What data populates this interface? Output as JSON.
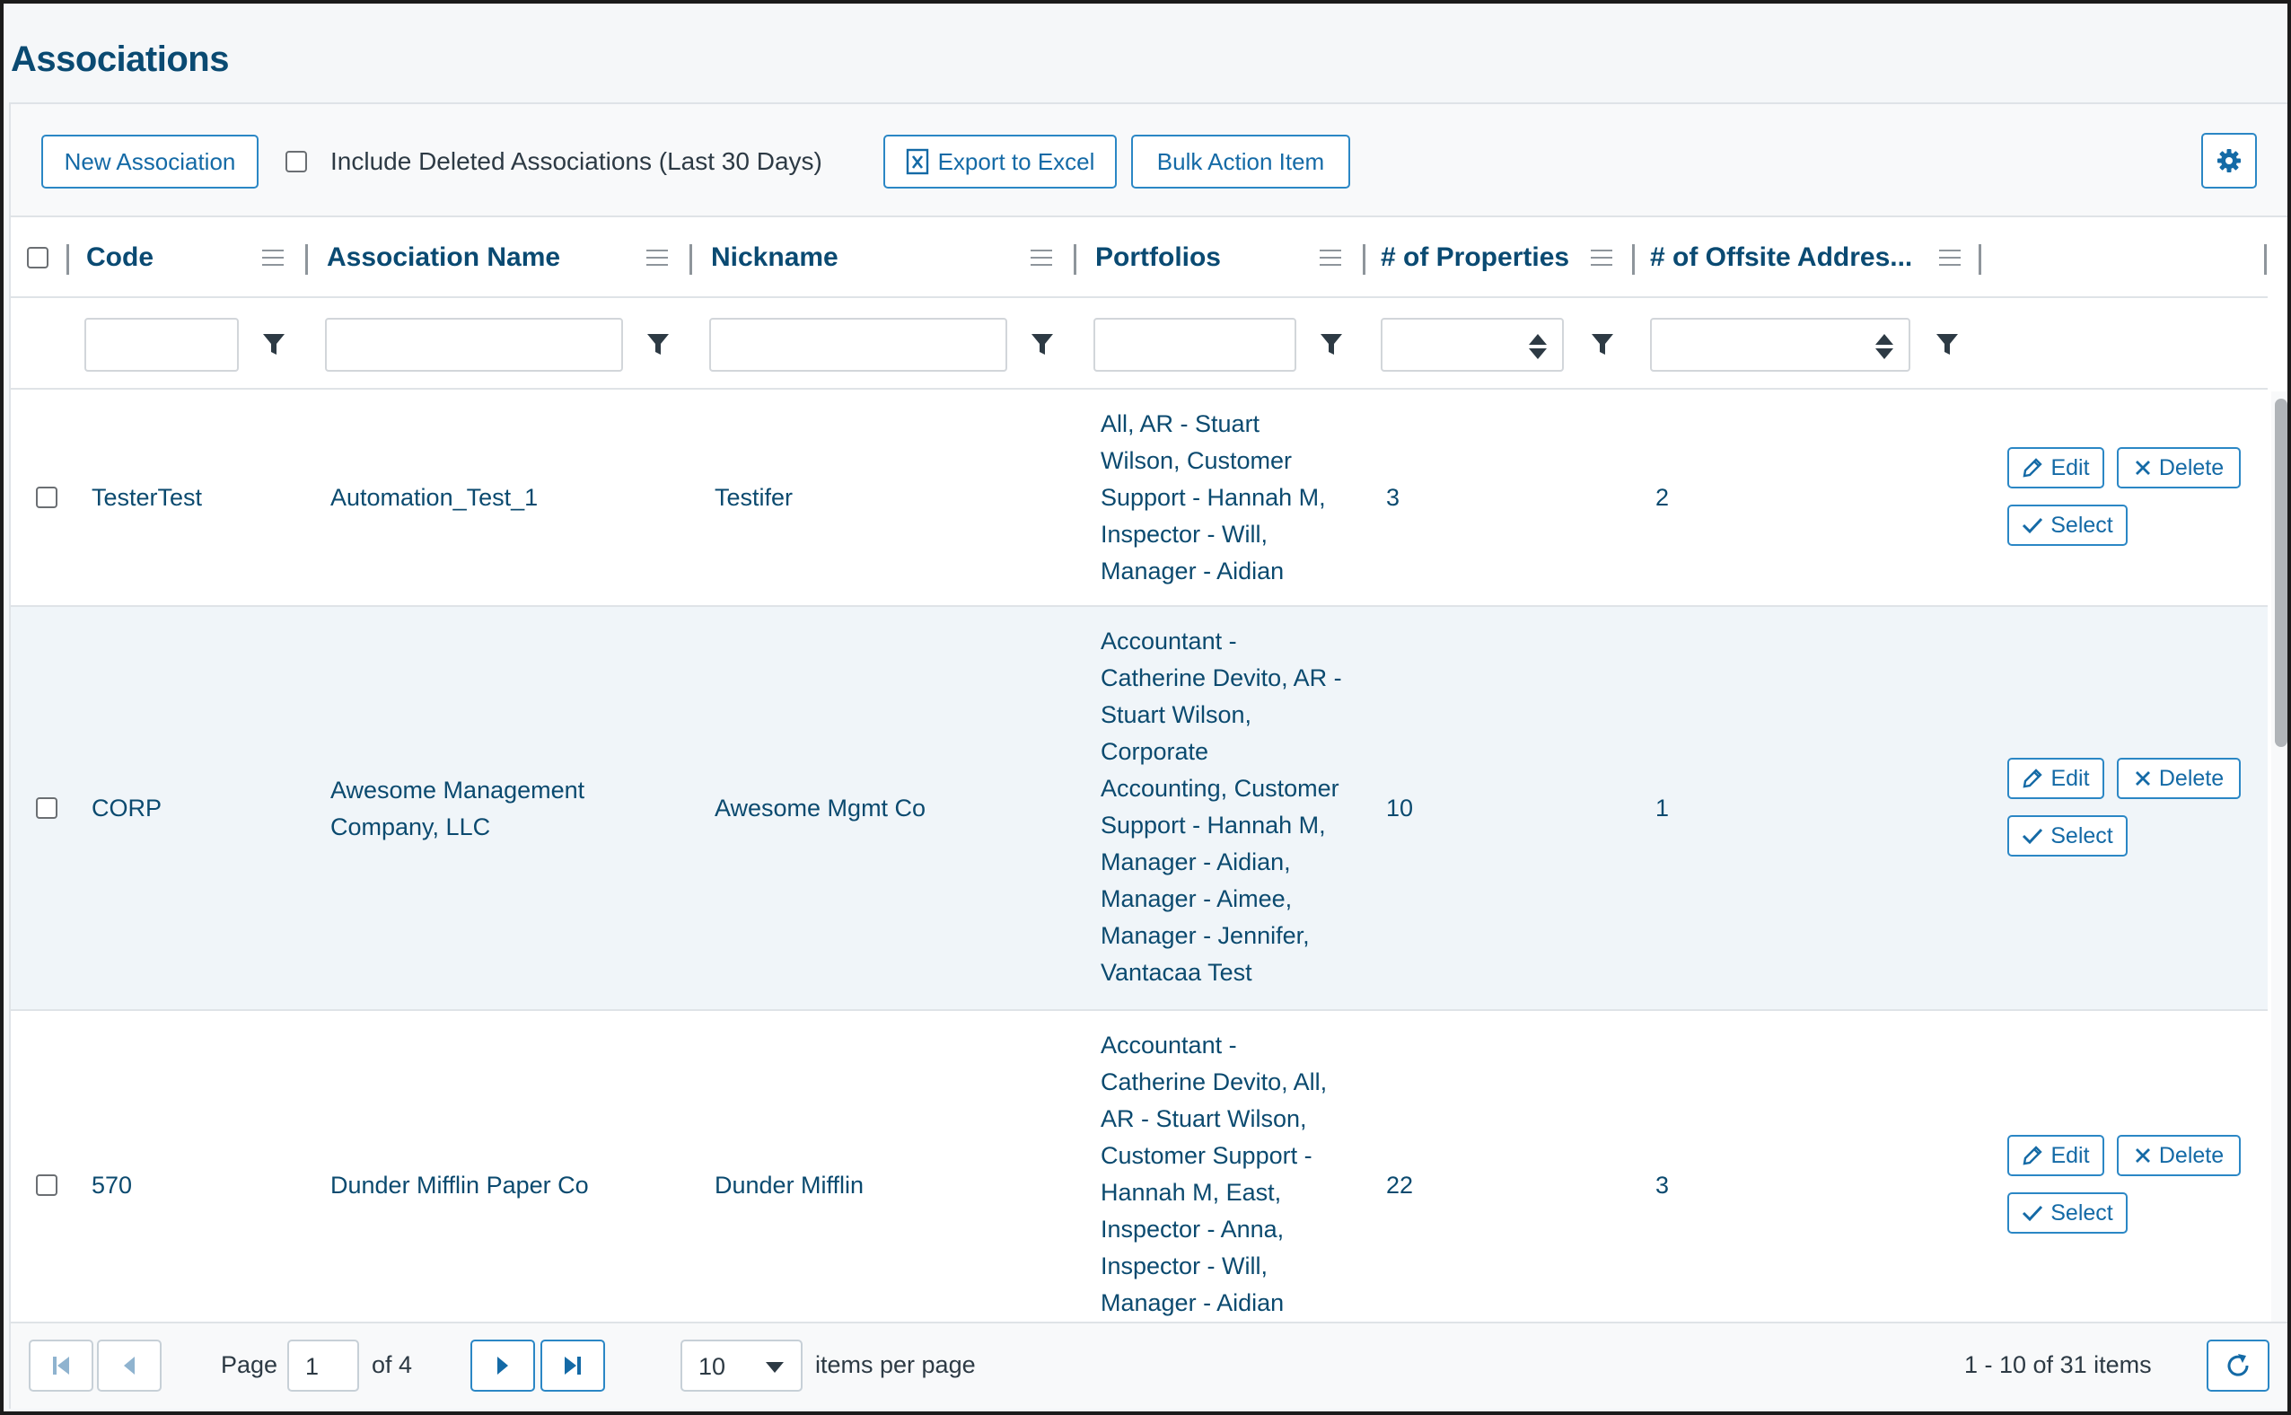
{
  "page": {
    "title": "Associations"
  },
  "toolbar": {
    "new_association": "New Association",
    "include_deleted": "Include Deleted Associations (Last 30 Days)",
    "export_excel": "Export to Excel",
    "bulk_action": "Bulk Action Item",
    "settings_icon": "gear-icon"
  },
  "columns": [
    {
      "label": "Code"
    },
    {
      "label": "Association Name"
    },
    {
      "label": "Nickname"
    },
    {
      "label": "Portfolios"
    },
    {
      "label": "# of Properties"
    },
    {
      "label": "# of Offsite Addres..."
    }
  ],
  "row_actions": {
    "edit": "Edit",
    "delete": "Delete",
    "select": "Select"
  },
  "rows": [
    {
      "code": "TesterTest",
      "name_lines": [
        "Automation_Test_1"
      ],
      "nickname": "Testifer",
      "portfolio_lines": [
        "All, AR - Stuart",
        "Wilson, Customer",
        "Support - Hannah M,",
        "Inspector - Will,",
        "Manager - Aidian"
      ],
      "properties": "3",
      "offsite": "2"
    },
    {
      "code": "CORP",
      "name_lines": [
        "Awesome Management",
        "Company, LLC"
      ],
      "nickname": "Awesome Mgmt Co",
      "portfolio_lines": [
        "Accountant -",
        "Catherine Devito, AR -",
        "Stuart Wilson,",
        "Corporate",
        "Accounting, Customer",
        "Support - Hannah M,",
        "Manager - Aidian,",
        "Manager - Aimee,",
        "Manager - Jennifer,",
        "Vantacaa Test"
      ],
      "properties": "10",
      "offsite": "1"
    },
    {
      "code": "570",
      "name_lines": [
        "Dunder Mifflin Paper Co"
      ],
      "nickname": "Dunder Mifflin",
      "portfolio_lines": [
        "Accountant -",
        "Catherine Devito, All,",
        "AR - Stuart Wilson,",
        "Customer Support -",
        "Hannah M, East,",
        "Inspector - Anna,",
        "Inspector - Will,",
        "Manager - Aidian"
      ],
      "properties": "22",
      "offsite": "3"
    }
  ],
  "pager": {
    "page_label": "Page",
    "page_value": "1",
    "of_label": "of 4",
    "page_size": "10",
    "items_per_page": "items per page",
    "summary": "1 - 10 of 31 items"
  }
}
